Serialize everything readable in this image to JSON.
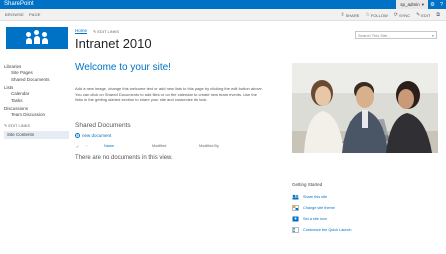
{
  "suite": {
    "brand": "SharePoint",
    "user": "sp_admin",
    "user_caret": "▾",
    "gear_glyph": "⚙",
    "help_glyph": "?"
  },
  "ribbon": {
    "tabs": [
      "BROWSE",
      "PAGE"
    ],
    "actions": [
      {
        "label": "SHARE",
        "icon": "share-icon",
        "glyph": "⇪"
      },
      {
        "label": "FOLLOW",
        "icon": "star-icon",
        "glyph": "☆"
      },
      {
        "label": "SYNC",
        "icon": "sync-icon",
        "glyph": "⟳"
      },
      {
        "label": "EDIT",
        "icon": "edit-icon",
        "glyph": "✎"
      },
      {
        "label": "",
        "icon": "focus-icon",
        "glyph": "⧉"
      }
    ]
  },
  "header": {
    "nav_home": "Home",
    "edit_links": "EDIT LINKS",
    "edit_glyph": "✎",
    "site_title": "Intranet 2010",
    "search_placeholder": "Search This Site...",
    "search_glyph": "⌕"
  },
  "quicklaunch": {
    "sections": [
      {
        "heading": "Libraries",
        "items": [
          "Site Pages",
          "Shared Documents"
        ]
      },
      {
        "heading": "Lists",
        "items": [
          "Calendar",
          "Tasks"
        ]
      },
      {
        "heading": "Discussions",
        "items": [
          "Team Discussion"
        ]
      }
    ],
    "edit_links": "EDIT LINKS",
    "site_contents": "Site Contents"
  },
  "main": {
    "welcome_title": "Welcome to your site!",
    "welcome_text": "Add a new image, change this welcome text or add new lists to this page by clicking the edit button above. You can click on Shared Documents to add files or on the calendar to create new team events. Use the links in the getting started section to share your site and customize its look.",
    "docs_title": "Shared Documents",
    "new_document": "new document",
    "new_glyph": "+",
    "columns": [
      "Name",
      "Modified",
      "Modified By"
    ],
    "check_glyph": "✓",
    "empty_message": "There are no documents in this view."
  },
  "getting_started": {
    "title": "Getting Started",
    "items": [
      {
        "label": "Share this site",
        "icon": "share-site-icon"
      },
      {
        "label": "Change site theme",
        "icon": "theme-icon"
      },
      {
        "label": "Set a site icon",
        "icon": "site-icon-icon"
      },
      {
        "label": "Customize the Quick Launch",
        "icon": "quick-launch-icon"
      }
    ]
  },
  "colors": {
    "accent": "#0072c6",
    "suitebar": "#0072c6",
    "ribbon_bg": "#f1f1f1",
    "selected_nav": "#e6ecf3"
  }
}
